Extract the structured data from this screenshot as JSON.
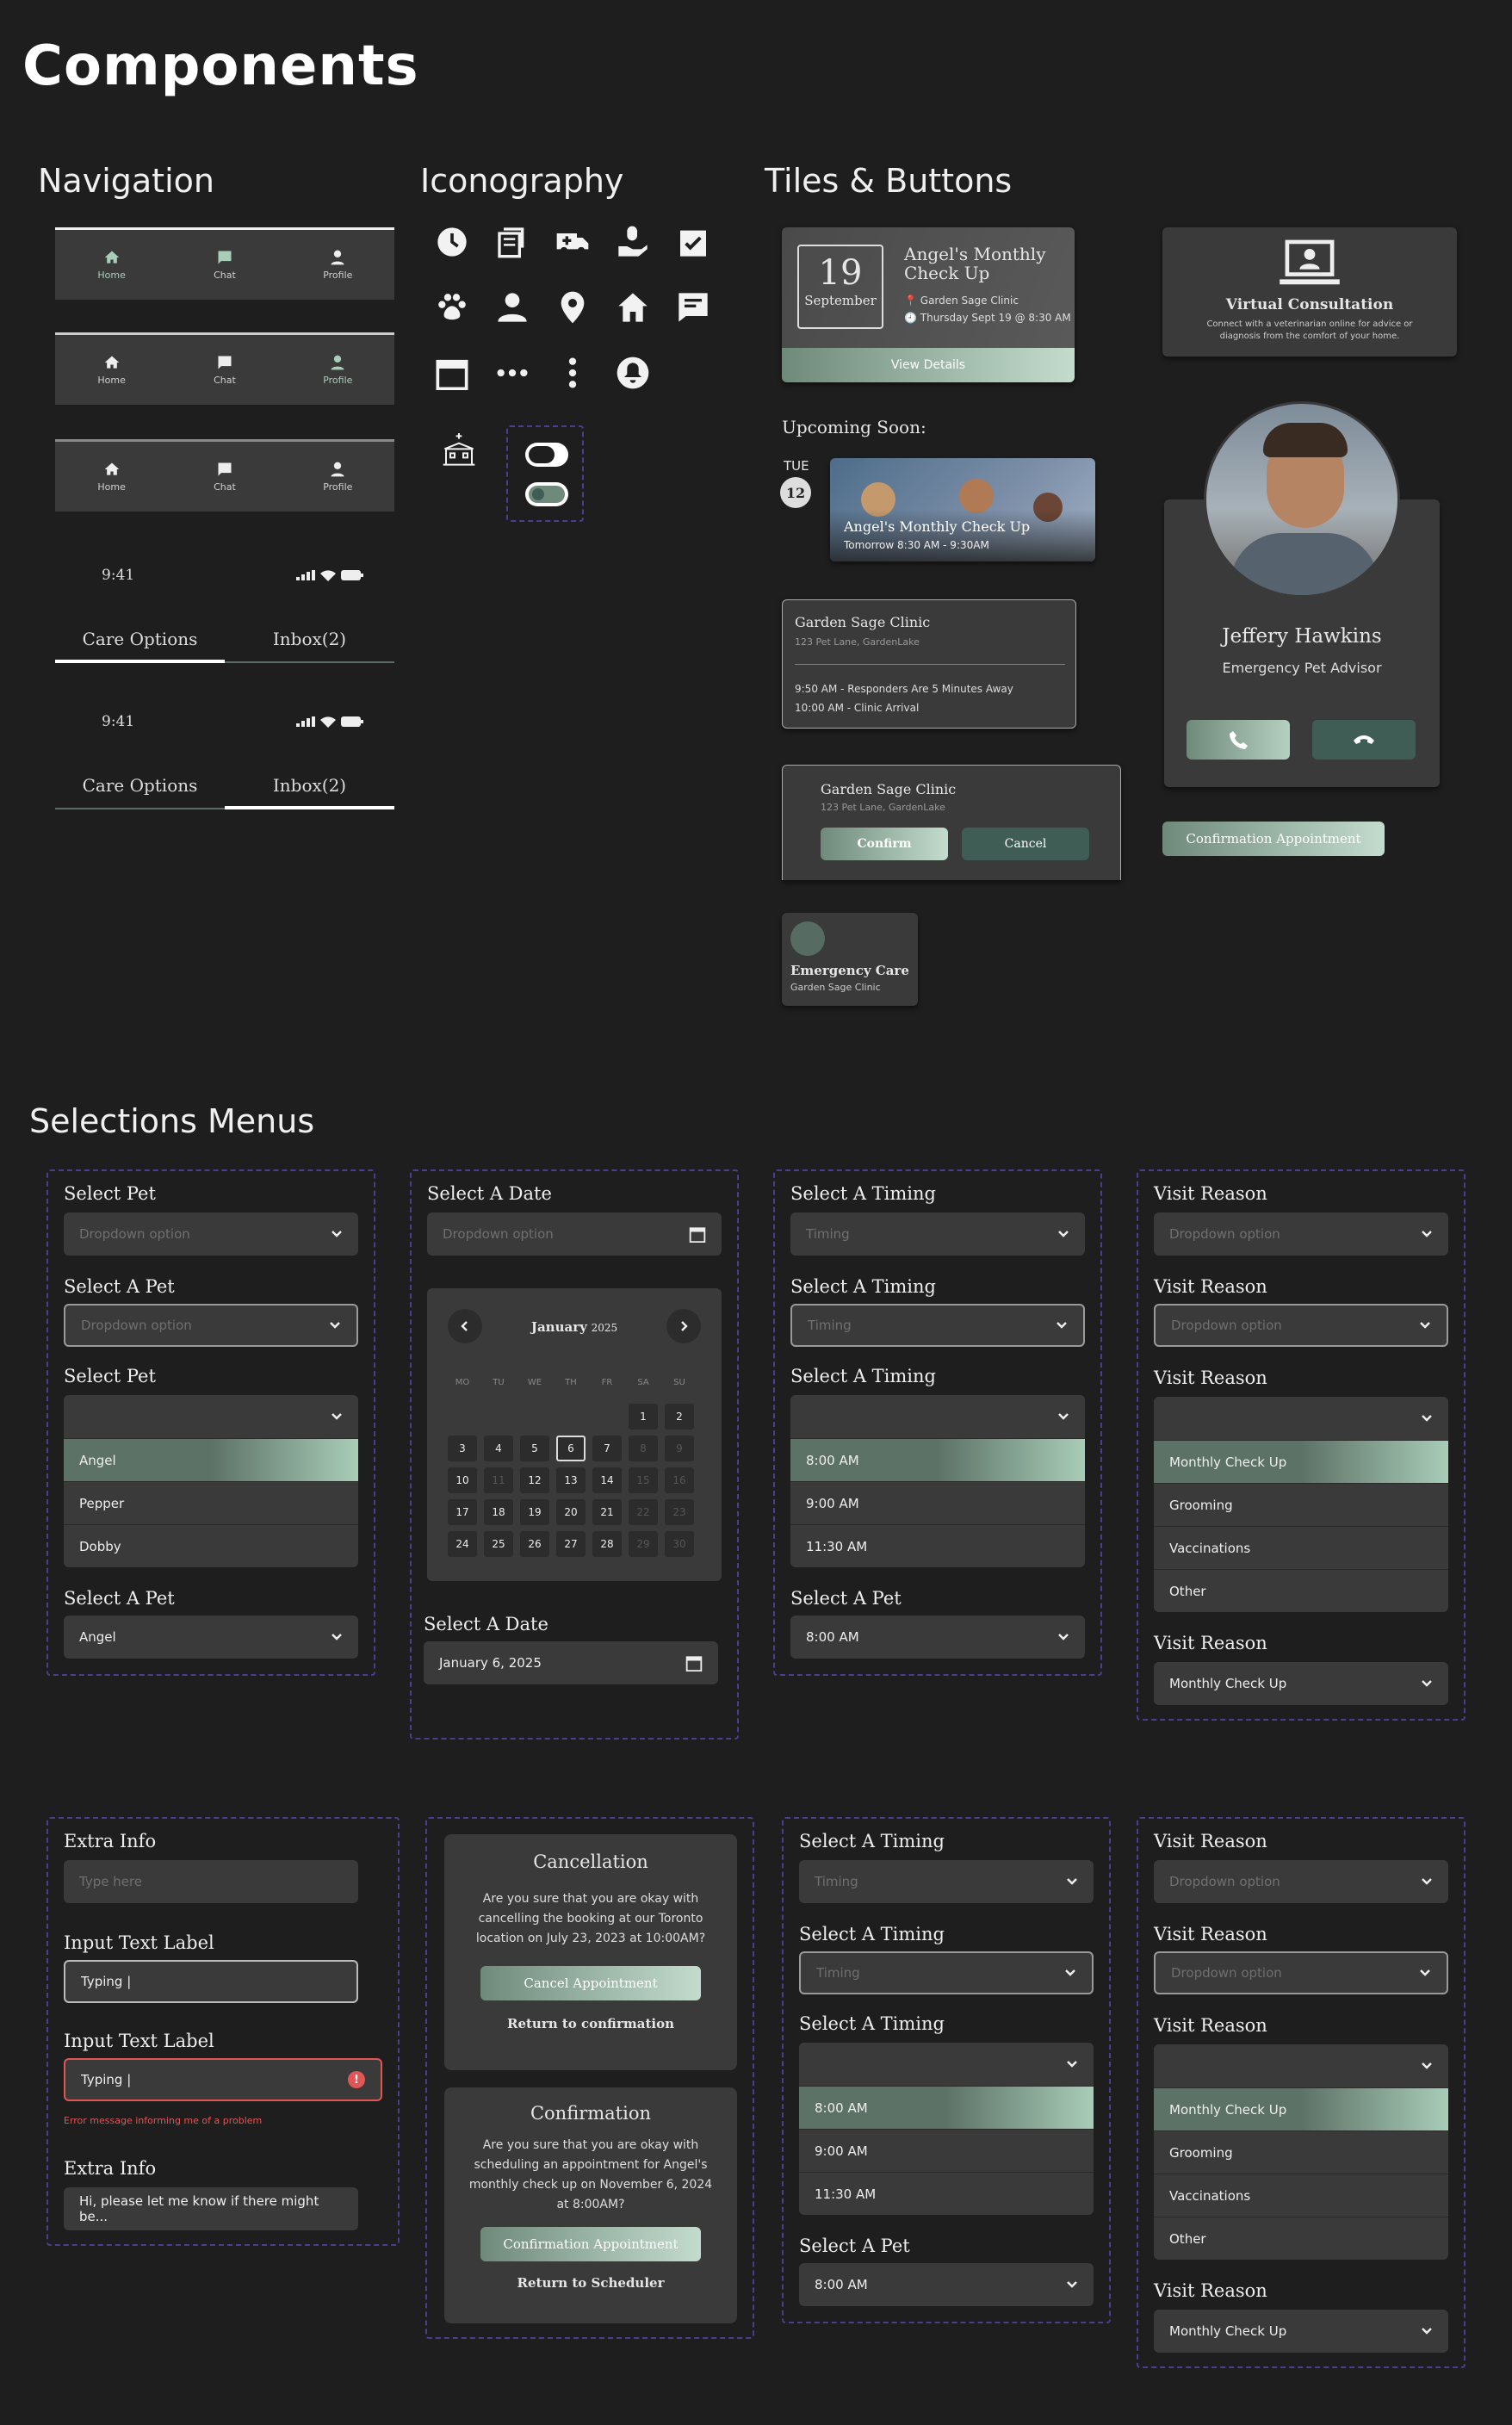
{
  "page_title": "Components",
  "sections": {
    "navigation": "Navigation",
    "iconography": "Iconography",
    "tiles": "Tiles & Buttons",
    "selections": "Selections Menus"
  },
  "navbar": {
    "home": "Home",
    "chat": "Chat",
    "profile": "Profile"
  },
  "status_bar": {
    "time": "9:41"
  },
  "tabs": {
    "care": "Care Options",
    "inbox": "Inbox(2)"
  },
  "appointment_tile": {
    "day": "19",
    "month": "September",
    "title": "Angel's Monthly Check Up",
    "clinic": "Garden Sage Clinic",
    "when": "Thursday Sept 19 @ 8:30 AM",
    "cta": "View Details"
  },
  "virtual": {
    "title": "Virtual Consultation",
    "desc": "Connect with a veterinarian online for advice or diagnosis from the comfort of your home."
  },
  "upcoming": {
    "heading": "Upcoming Soon:",
    "dow": "TUE",
    "day": "12",
    "title": "Angel's Monthly Check Up",
    "time": "Tomorrow 8:30 AM - 9:30AM"
  },
  "clinic_card": {
    "name": "Garden Sage Clinic",
    "address": "123 Pet Lane, GardenLake",
    "line1": "9:50 AM - Responders Are 5 Minutes Away",
    "line2": "10:00 AM - Clinic Arrival"
  },
  "confirm_card": {
    "name": "Garden Sage Clinic",
    "address": "123 Pet Lane, GardenLake",
    "confirm": "Confirm",
    "cancel": "Cancel"
  },
  "emergency": {
    "title": "Emergency Care",
    "sub": "Garden Sage Clinic"
  },
  "advisor": {
    "name": "Jeffery Hawkins",
    "role": "Emergency Pet Advisor"
  },
  "confirmation_btn": "Confirmation Appointment",
  "sel": {
    "select_pet": "Select Pet",
    "select_a_pet": "Select A Pet",
    "select_date": "Select A Date",
    "select_timing": "Select A Timing",
    "visit_reason": "Visit Reason",
    "dropdown_option": "Dropdown option",
    "timing": "Timing",
    "pets": [
      "Angel",
      "Pepper",
      "Dobby"
    ],
    "times": [
      "8:00 AM",
      "9:00 AM",
      "11:30 AM"
    ],
    "reasons": [
      "Monthly Check Up",
      "Grooming",
      "Vaccinations",
      "Other"
    ],
    "date_value": "January 6, 2025"
  },
  "calendar": {
    "month": "January",
    "year": "2025",
    "weekdays": [
      "MO",
      "TU",
      "WE",
      "TH",
      "FR",
      "SA",
      "SU"
    ],
    "rows": [
      [
        "",
        "",
        "",
        "",
        "",
        "1",
        "2"
      ],
      [
        "3",
        "4",
        "5",
        "6",
        "7",
        "8",
        "9"
      ],
      [
        "10",
        "11",
        "12",
        "13",
        "14",
        "15",
        "16"
      ],
      [
        "17",
        "18",
        "19",
        "20",
        "21",
        "22",
        "23"
      ],
      [
        "24",
        "25",
        "26",
        "27",
        "28",
        "29",
        "30"
      ]
    ]
  },
  "inputs": {
    "extra_info": "Extra Info",
    "type_here": "Type here",
    "input_label": "Input Text Label",
    "typing": "Typing |",
    "error": "Error message informing me of a problem",
    "extra_value": "Hi, please let me know if there might be..."
  },
  "cancel_modal": {
    "title": "Cancellation",
    "body": "Are you sure that you are okay with cancelling the booking at our Toronto location on July 23, 2023 at 10:00AM?",
    "primary": "Cancel Appointment",
    "secondary": "Return to confirmation"
  },
  "confirm_modal": {
    "title": "Confirmation",
    "body": "Are you sure that you are okay with scheduling an appointment for Angel's monthly check up on November 6, 2024 at 8:00AM?",
    "primary": "Confirmation Appointment",
    "secondary": "Return to Scheduler"
  },
  "colors": {
    "accent": "#a9cdb8",
    "dark_green": "#3f5d55",
    "error": "#e05555",
    "panel_border": "#4a3f8f"
  }
}
